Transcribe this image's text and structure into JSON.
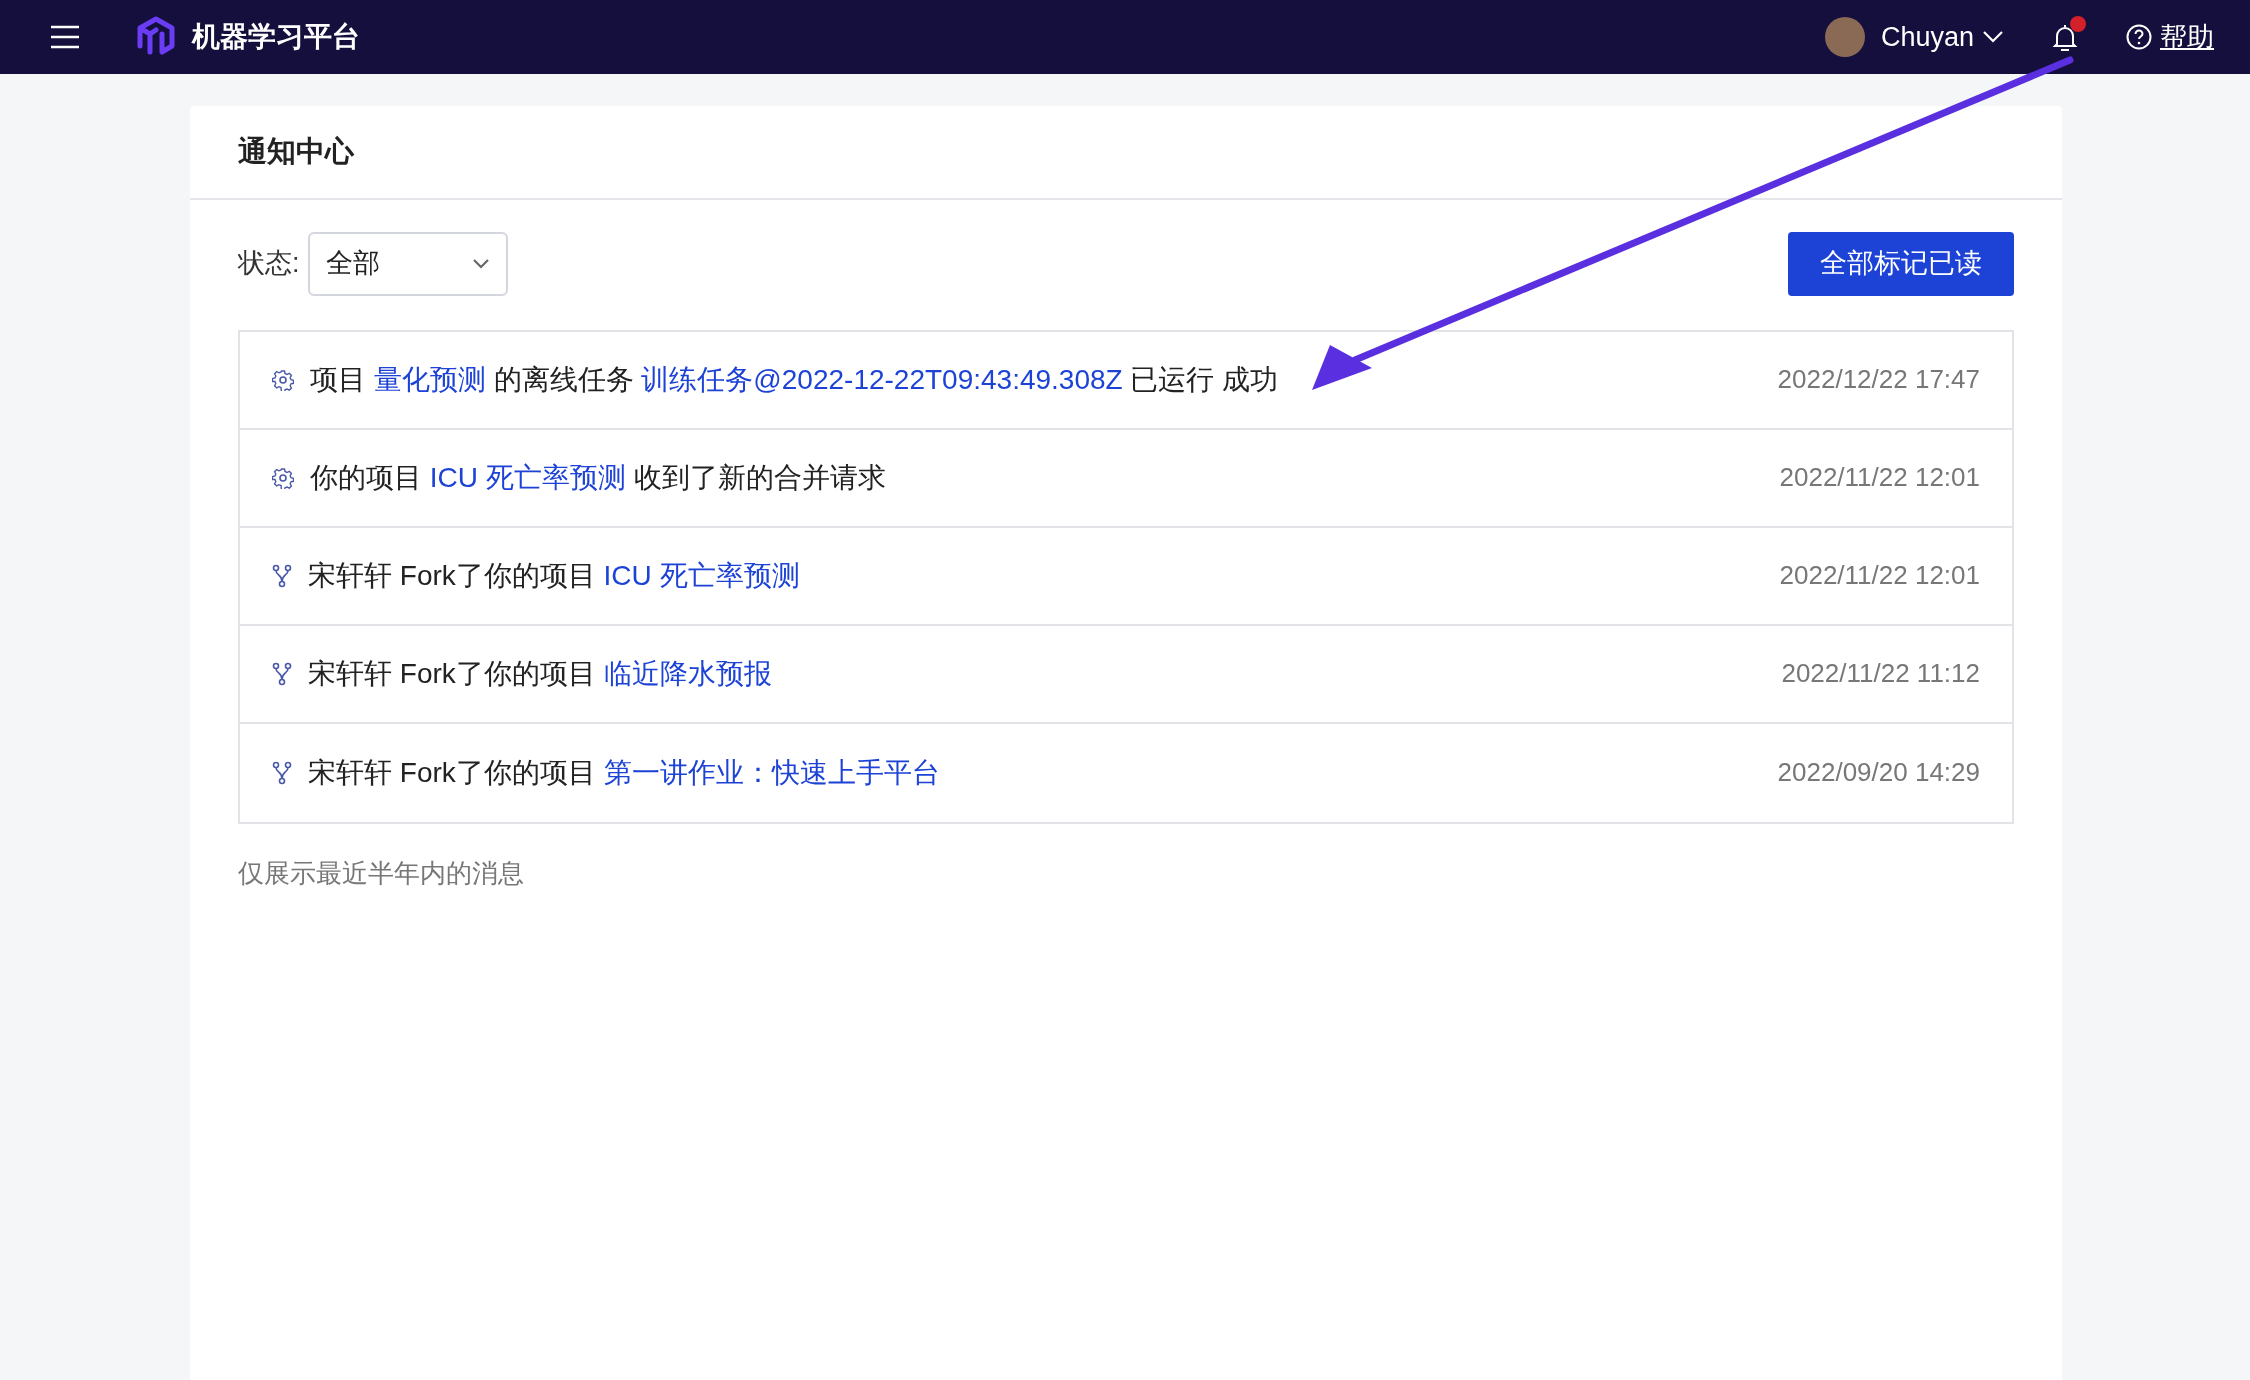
{
  "header": {
    "app_title": "机器学习平台",
    "user_name": "Chuyan",
    "has_unread": true,
    "help": "帮助"
  },
  "page_title": "通知中心",
  "filter": {
    "label": "状态:",
    "value": "全部"
  },
  "mark_all_button": "全部标记已读",
  "notifications": [
    {
      "kind": "gear",
      "time": "2022/12/22 17:47",
      "parts": [
        {
          "text": "项目 ",
          "link": false
        },
        {
          "text": "量化预测",
          "link": true
        },
        {
          "text": " 的离线任务 ",
          "link": false
        },
        {
          "text": "训练任务@2022-12-22T09:43:49.308Z",
          "link": true
        },
        {
          "text": " 已运行 成功",
          "link": false
        }
      ]
    },
    {
      "kind": "gear",
      "time": "2022/11/22 12:01",
      "parts": [
        {
          "text": "你的项目 ",
          "link": false
        },
        {
          "text": "ICU 死亡率预测",
          "link": true
        },
        {
          "text": " 收到了新的合并请求",
          "link": false
        }
      ]
    },
    {
      "kind": "fork",
      "time": "2022/11/22 12:01",
      "parts": [
        {
          "text": "宋轩轩 Fork了你的项目 ",
          "link": false
        },
        {
          "text": "ICU 死亡率预测",
          "link": true
        }
      ]
    },
    {
      "kind": "fork",
      "time": "2022/11/22 11:12",
      "parts": [
        {
          "text": "宋轩轩 Fork了你的项目 ",
          "link": false
        },
        {
          "text": "临近降水预报",
          "link": true
        }
      ]
    },
    {
      "kind": "fork",
      "time": "2022/09/20 14:29",
      "parts": [
        {
          "text": "宋轩轩 Fork了你的项目 ",
          "link": false
        },
        {
          "text": "第一讲作业：快速上手平台",
          "link": true
        }
      ]
    }
  ],
  "footnote": "仅展示最近半年内的消息"
}
